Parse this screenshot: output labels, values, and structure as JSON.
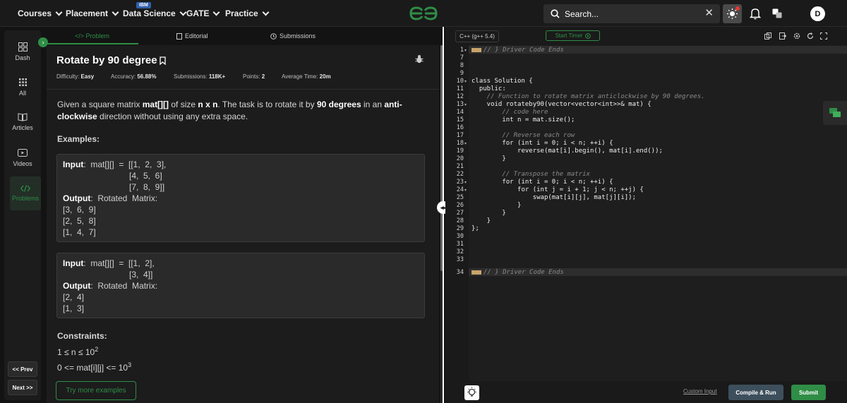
{
  "nav": {
    "items": [
      "Courses",
      "Placement",
      "Data Science",
      "GATE",
      "Practice"
    ],
    "badge": "IBM",
    "search_placeholder": "Search...",
    "avatar_letter": "D"
  },
  "sidebar": {
    "items": [
      "Dash",
      "All",
      "Articles",
      "Videos",
      "Problems"
    ],
    "prev": "<< Prev",
    "next": "Next >>"
  },
  "tabs": [
    "</> Problem",
    "Editorial",
    "Submissions"
  ],
  "problem": {
    "title": "Rotate by 90 degree",
    "difficulty_label": "Difficulty:",
    "difficulty": "Easy",
    "accuracy_label": "Accuracy:",
    "accuracy": "56.88%",
    "submissions_label": "Submissions:",
    "submissions": "118K+",
    "points_label": "Points:",
    "points": "2",
    "avg_time_label": "Average Time:",
    "avg_time": "20m",
    "desc_1": "Given a square matrix ",
    "desc_b1": "mat[][]",
    "desc_2": " of size ",
    "desc_b2": "n x n",
    "desc_3": ". The task is to rotate it by ",
    "desc_b3": "90 degrees",
    "desc_4": " in an ",
    "desc_b4": "anti-",
    "desc_b5": "clockwise",
    "desc_5": " direction without using any extra space.",
    "examples_heading": "Examples:",
    "ex1": [
      "Input:  mat[][]  =  [[1,  2,  3],",
      "[4,  5,  6]",
      "[7,  8,  9]]",
      "Output:  Rotated  Matrix:",
      "[3,  6,  9]",
      "[2,  5,  8]",
      "[1,  4,  7]"
    ],
    "ex2": [
      "Input:  mat[][]  =  [[1,  2],",
      "[3,  4]]",
      "Output:  Rotated  Matrix:",
      "[2,  4]",
      "[1,  3]"
    ],
    "constraints_heading": "Constraints:",
    "c1": "1 ≤ n ≤ 10",
    "c1_sup": "2",
    "c2": "0 <= mat[i][j] <= 10",
    "c2_sup": "3",
    "try_more": "Try more examples"
  },
  "editor": {
    "language": "C++ (g++ 5.4)",
    "timer": "Start Timer",
    "custom_input": "Custom Input",
    "compile": "Compile & Run",
    "submit": "Submit",
    "lines": [
      {
        "n": "1",
        "t": "// } Driver Code Ends"
      },
      {
        "n": "7",
        "t": ""
      },
      {
        "n": "8",
        "t": ""
      },
      {
        "n": "9",
        "t": ""
      },
      {
        "n": "10",
        "t": "class Solution {"
      },
      {
        "n": "11",
        "t": "  public:"
      },
      {
        "n": "12",
        "t": "    // Function to rotate matrix anticlockwise by 90 degrees."
      },
      {
        "n": "13",
        "t": "    void rotateby90(vector<vector<int>>& mat) {"
      },
      {
        "n": "14",
        "t": "        // code here"
      },
      {
        "n": "15",
        "t": "        int n = mat.size();"
      },
      {
        "n": "16",
        "t": ""
      },
      {
        "n": "17",
        "t": "        // Reverse each row"
      },
      {
        "n": "18",
        "t": "        for (int i = 0; i < n; ++i) {"
      },
      {
        "n": "19",
        "t": "            reverse(mat[i].begin(), mat[i].end());"
      },
      {
        "n": "20",
        "t": "        }"
      },
      {
        "n": "21",
        "t": ""
      },
      {
        "n": "22",
        "t": "        // Transpose the matrix"
      },
      {
        "n": "23",
        "t": "        for (int i = 0; i < n; ++i) {"
      },
      {
        "n": "24",
        "t": "            for (int j = i + 1; j < n; ++j) {"
      },
      {
        "n": "25",
        "t": "                swap(mat[i][j], mat[j][i]);"
      },
      {
        "n": "26",
        "t": "            }"
      },
      {
        "n": "27",
        "t": "        }"
      },
      {
        "n": "28",
        "t": "    }"
      },
      {
        "n": "29",
        "t": "};"
      },
      {
        "n": "30",
        "t": ""
      },
      {
        "n": "31",
        "t": ""
      },
      {
        "n": "32",
        "t": ""
      },
      {
        "n": "33",
        "t": ""
      },
      {
        "n": "34",
        "t": "// } Driver Code Ends"
      }
    ]
  },
  "colors": {
    "accent": "#2f8d46",
    "bg": "#131313",
    "panel": "#1c1c1c"
  }
}
